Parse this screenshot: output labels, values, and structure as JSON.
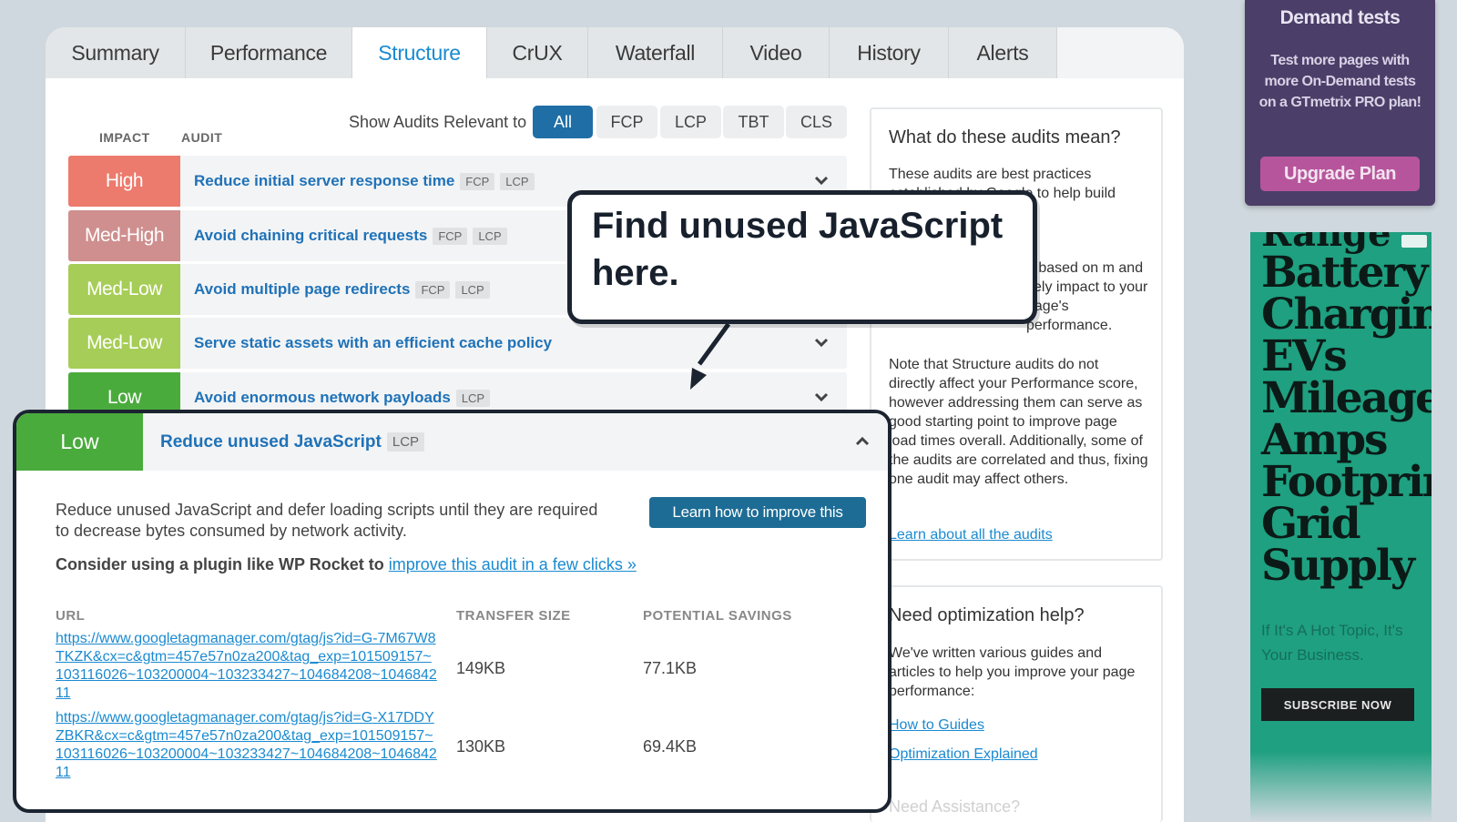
{
  "tabs": [
    "Summary",
    "Performance",
    "Structure",
    "CrUX",
    "Waterfall",
    "Video",
    "History",
    "Alerts"
  ],
  "active_tab": "Structure",
  "filter": {
    "label": "Show Audits Relevant to",
    "options": [
      "All",
      "FCP",
      "LCP",
      "TBT",
      "CLS"
    ],
    "active": "All"
  },
  "columns": {
    "impact": "IMPACT",
    "audit": "AUDIT"
  },
  "audits": [
    {
      "impact": "High",
      "title": "Reduce initial server response time",
      "tags": [
        "FCP",
        "LCP"
      ],
      "color": "#ec7a6d"
    },
    {
      "impact": "Med-High",
      "title": "Avoid chaining critical requests",
      "tags": [
        "FCP",
        "LCP"
      ],
      "color": "#cf8f8f"
    },
    {
      "impact": "Med-Low",
      "title": "Avoid multiple page redirects",
      "tags": [
        "FCP",
        "LCP"
      ],
      "color": "#a6cd57"
    },
    {
      "impact": "Med-Low",
      "title": "Serve static assets with an efficient cache policy",
      "tags": [],
      "color": "#a6cd57"
    },
    {
      "impact": "Low",
      "title": "Avoid enormous network payloads",
      "tags": [
        "LCP"
      ],
      "color": "#4aab3d"
    }
  ],
  "expanded_audit": {
    "impact": "Low",
    "title": "Reduce unused JavaScript",
    "tag": "LCP",
    "description": "Reduce unused JavaScript and defer loading scripts until they are required to decrease bytes consumed by network activity.",
    "consider_text": "Consider using a plugin like WP Rocket to",
    "consider_link": "improve this audit in a few clicks »",
    "learn_button": "Learn how to improve this",
    "table_headers": [
      "URL",
      "TRANSFER SIZE",
      "POTENTIAL SAVINGS"
    ],
    "rows": [
      {
        "url": "https://www.googletagmanager.com/gtag/js?id=G-7M67W8TKZK&cx=c&gtm=457e57n0za200&tag_exp=101509157~103116026~103200004~103233427~104684208~104684211",
        "transfer": "149KB",
        "savings": "77.1KB"
      },
      {
        "url": "https://www.googletagmanager.com/gtag/js?id=G-X17DDYZBKR&cx=c&gtm=457e57n0za200&tag_exp=101509157~103116026~103200004~103233427~104684208~104684211",
        "transfer": "130KB",
        "savings": "69.4KB"
      }
    ]
  },
  "callout": {
    "text": "Find unused JavaScript here."
  },
  "sidebar": {
    "box1_title": "What do these audits mean?",
    "box1_p1": "These audits are best practices established by Google to help build faster front-end",
    "box1_p2": "d based on m and kely impact to your page's performance.",
    "box1_p3": "Note that Structure audits do not directly affect your Performance score, however addressing them can serve as good starting point to improve page load times overall. Additionally, some of the audits are correlated and thus, fixing one audit may affect others.",
    "box1_link": "Learn about all the audits",
    "box2_title": "Need optimization help?",
    "box2_text": "We've written various guides and articles to help you improve your page performance:",
    "box2_link1": "How to Guides",
    "box2_link2": "Optimization Explained",
    "box3_title": "Need Assistance?"
  },
  "ad_top": {
    "title": "Demand tests",
    "text": "Test more pages with more On-Demand tests on a GTmetrix PRO plan!",
    "button": "Upgrade Plan"
  },
  "ad_side": {
    "cropped": "Range",
    "words": [
      "Battery",
      "Charging",
      "EVs",
      "Mileage",
      "Amps",
      "Footprint",
      "Grid",
      "Supply"
    ],
    "tagline": "If It's A Hot Topic, It's Your Business.",
    "button": "SUBSCRIBE NOW"
  },
  "colors": {
    "accent": "#1a8ad0",
    "filter_active": "#1f6ea6",
    "low": "#4aab3d",
    "callout_border": "#1b2430"
  }
}
